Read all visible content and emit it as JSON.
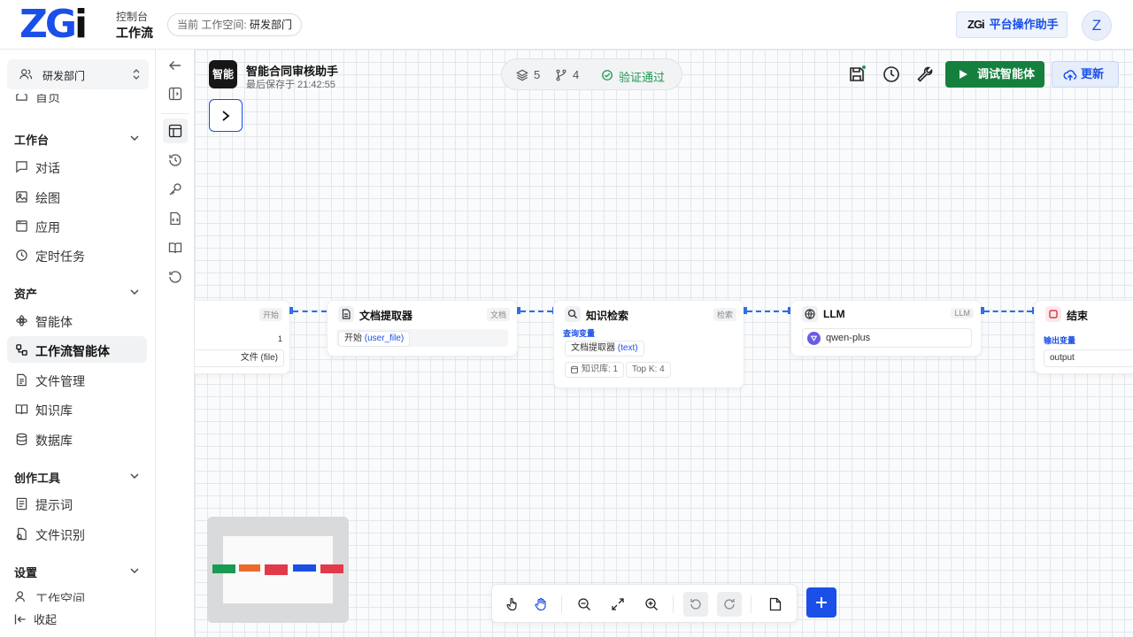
{
  "header": {
    "logo": {
      "main": "ZG",
      "tail": "i"
    },
    "console": "控制台",
    "section": "工作流",
    "workspace_prefix": "当前 工作空间:",
    "workspace_name": "研发部门",
    "assistant_mini": "ZGi",
    "assistant_label": "平台操作助手",
    "avatar": "Z"
  },
  "sidebar": {
    "org": "研发部门",
    "partial_top": "首页",
    "sections": [
      {
        "title": "工作台",
        "items": [
          "对话",
          "绘图",
          "应用",
          "定时任务"
        ]
      },
      {
        "title": "资产",
        "items": [
          "智能体",
          "工作流智能体",
          "文件管理",
          "知识库",
          "数据库"
        ]
      },
      {
        "title": "创作工具",
        "items": [
          "提示词",
          "文件识别"
        ]
      },
      {
        "title": "设置",
        "items": [
          "工作空间"
        ]
      }
    ],
    "active_item": "工作流智能体",
    "collapse": "收起"
  },
  "agent": {
    "badge": "智能",
    "title": "智能合同审核助手",
    "saved": "最后保存于 21:42:55"
  },
  "stats": {
    "nodes": "5",
    "edges": "4",
    "status": "验证通过"
  },
  "toolbar": {
    "run": "调试智能体",
    "update": "更新"
  },
  "nodes": {
    "start": {
      "tag": "开始",
      "row1": "1",
      "row2": "文件 (file)"
    },
    "extract": {
      "title": "文档提取器",
      "tag": "文档",
      "input_prefix": "开始",
      "input_var": "(user_file)"
    },
    "search": {
      "title": "知识检索",
      "tag": "检索",
      "query_label": "查询变量",
      "query_prefix": "文档提取器",
      "query_var": "(text)",
      "kb": "知识库: 1",
      "topk": "Top K: 4"
    },
    "llm": {
      "title": "LLM",
      "tag": "LLM",
      "model": "qwen-plus"
    },
    "end": {
      "title": "结束",
      "out_label": "输出变量",
      "out_var": "output"
    }
  },
  "minimap": {
    "colors": [
      "#1a9b53",
      "#ea6a2a",
      "#e23a4a",
      "#1a4fe8",
      "#e23a4a"
    ]
  },
  "colors": {
    "accent": "#1a4fe8",
    "success": "#15803d"
  }
}
